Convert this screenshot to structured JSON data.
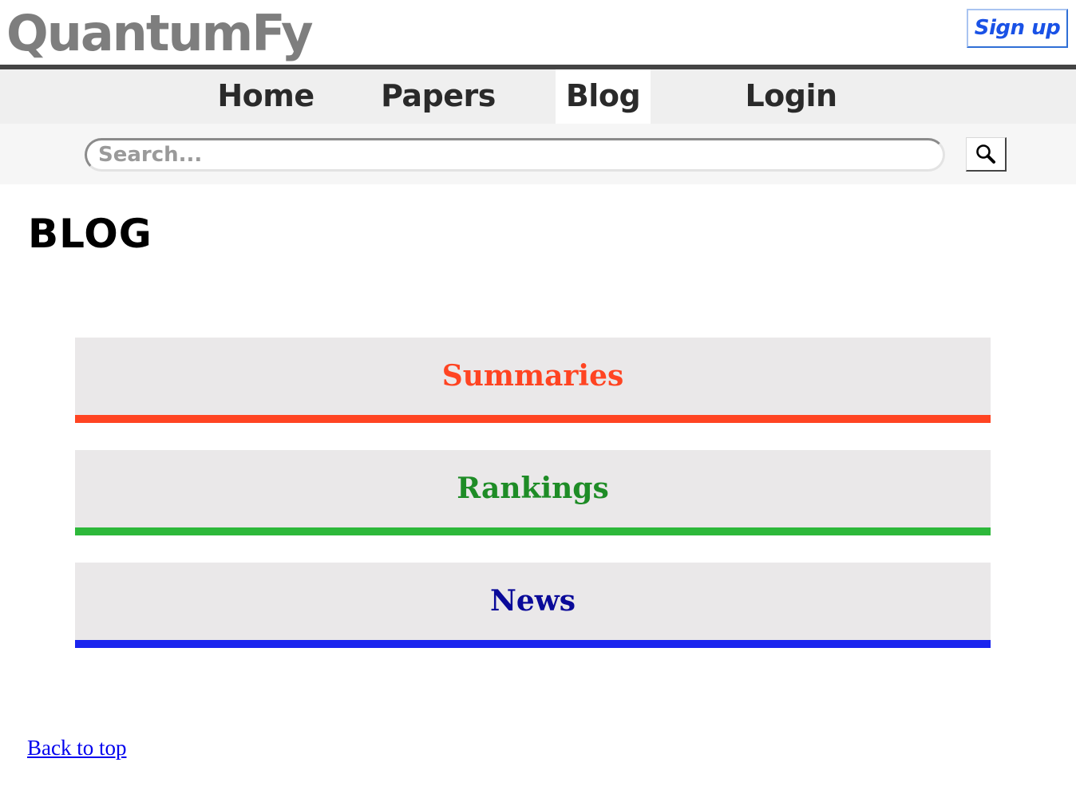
{
  "header": {
    "logo_text": "QuantumFy",
    "signup_label": "Sign up"
  },
  "nav": {
    "items": [
      {
        "label": "Home",
        "active": false
      },
      {
        "label": "Papers",
        "active": false
      },
      {
        "label": "Blog",
        "active": true
      },
      {
        "label": "Login",
        "active": false
      }
    ]
  },
  "search": {
    "placeholder": "Search...",
    "value": "",
    "button_icon": "magnifier-icon"
  },
  "main": {
    "page_title": "BLOG",
    "categories": [
      {
        "label": "Summaries",
        "text_color": "#ff4422",
        "bar_color": "#ff4422"
      },
      {
        "label": "Rankings",
        "text_color": "#1e8c26",
        "bar_color": "#2db83a"
      },
      {
        "label": "News",
        "text_color": "#0a0a99",
        "bar_color": "#1a24ee"
      }
    ]
  },
  "footer": {
    "back_to_top": "Back to top"
  }
}
